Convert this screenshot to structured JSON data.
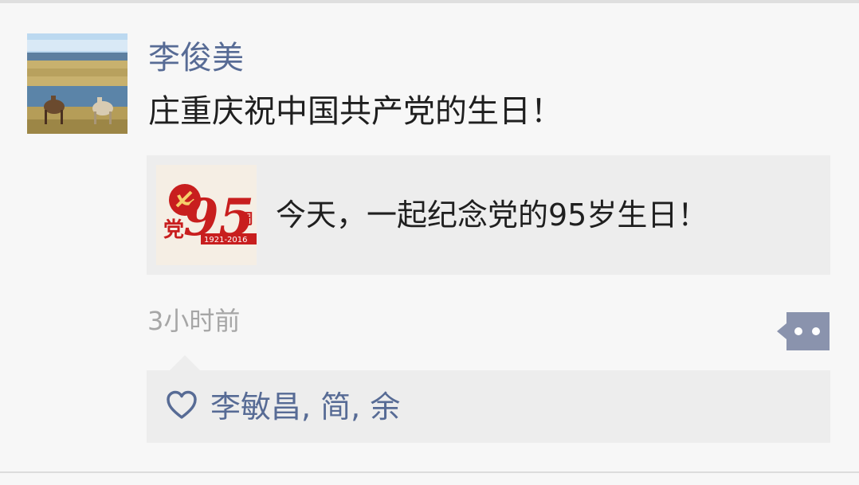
{
  "moment": {
    "author": "李俊美",
    "text": "庄重庆祝中国共产党的生日！",
    "link": {
      "title": "今天，一起纪念党的95岁生日！",
      "thumbnail": {
        "number": "95",
        "left_char": "党",
        "right_char": "周",
        "years": "1921-2016"
      }
    },
    "time": "3小时前",
    "likes": {
      "names": "李敏昌, 简, 余"
    }
  },
  "colors": {
    "name_link": "#576b95",
    "background": "#f7f7f7",
    "panel": "#ededed",
    "timestamp": "#a6a6a6",
    "more_button": "#8a93ad"
  },
  "icons": {
    "avatar": "landscape-with-horses",
    "more": "comment-more-icon",
    "like": "heart-outline-icon"
  }
}
